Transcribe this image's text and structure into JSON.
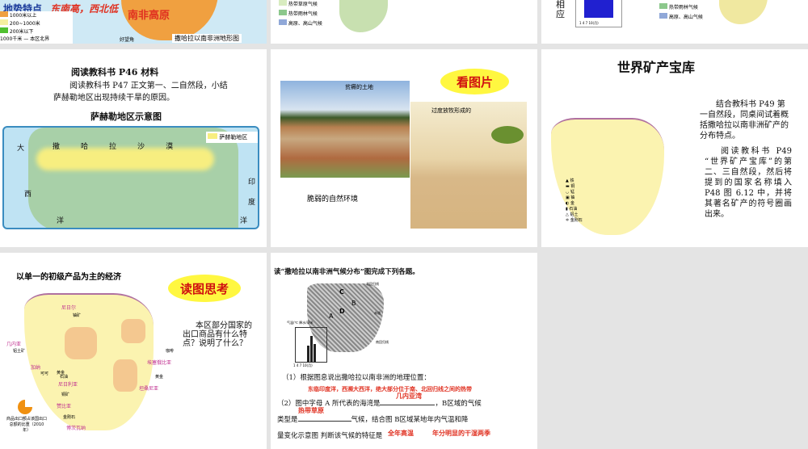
{
  "slides": [
    {
      "terrain": "地势特点",
      "terrain_value": "东南高，西北低",
      "plateau": "南非高原",
      "legend": [
        "1000米以上",
        "200~1000米",
        "200米以下"
      ],
      "scale": "1000千米",
      "boundary": "本区北界",
      "cape": "好望角",
      "caption": "撒哈拉以南非洲地形图"
    },
    {
      "legend": [
        "热带草原气候",
        "热带雨林气候",
        "高原、高山气候"
      ]
    },
    {
      "side": "相应",
      "legend": [
        "热带雨林气候",
        "高原、高山气候"
      ],
      "chart_months": "1 4 7 10(月)"
    },
    {
      "title": "阅读教科书 P46 材料",
      "body": "阅读教科书 P47 正文第一、二自然段，小结萨赫勒地区出现持续干旱的原因。",
      "map_title": "萨赫勒地区示意图",
      "legend": "萨赫勒地区",
      "labels": [
        "撒",
        "哈",
        "拉",
        "沙",
        "漠",
        "大",
        "西",
        "洋",
        "印",
        "度",
        "洋"
      ]
    },
    {
      "photo1": "贫瘠的土地",
      "photo2": "过度放牧形成的",
      "cloud": "看图片",
      "caption": "脆弱的自然环境"
    },
    {
      "title": "世界矿产宝库",
      "p1": "结合教科书 P49 第一自然段，同桌间试着概括撒哈拉以南非洲矿产的分布特点。",
      "p2": "阅读教科书 P49 “世界矿产宝库”的第二、三自然段，然后将提到的国家名称填入 P48 图 6.12 中，并将其著名矿产的符号圈画出来。",
      "legend": [
        "铁",
        "铜",
        "锰",
        "铀",
        "金",
        "石油",
        "铝土",
        "金刚石"
      ]
    },
    {
      "title": "以单一的初级产品为主的经济",
      "cloud": "读图思考",
      "body": "本区部分国家的出口商品有什么特点？说明了什么？",
      "countries": [
        "尼日尔",
        "几内亚",
        "加纳",
        "尼日利亚",
        "赞比亚",
        "博茨瓦纳",
        "埃塞俄比亚",
        "坦桑尼亚"
      ],
      "products": [
        "铀矿",
        "铝土矿",
        "黄金",
        "可可",
        "石油",
        "铜矿",
        "金刚石",
        "咖啡",
        "黄金"
      ],
      "legend_note": "商品出口额占该国出口总额的比重（2010年）"
    },
    {
      "title": "读“撒哈拉以南非洲气候分布”图完成下列各题。",
      "q1": "（1）根据图息说出撒哈拉以南非洲的地理位置：",
      "a1": "东临印度洋，西濒大西洋，绝大部分位于南、北回归线之间的热带",
      "q2a": "（2）图中字母 A 所代表的海湾是",
      "a2a": "几内亚湾",
      "q2b": "，B区域的气候",
      "q2c": "类型是",
      "a2b": "热带草原",
      "q2d": "气候，结合图 B区域某地年内气温和降",
      "q2e": "量变化示意图 判断该气候的特征是",
      "a2c": "全年高温",
      "a2d": "年分明显的干湿两季",
      "map_labels": [
        "C",
        "B",
        "D",
        "A",
        "北回归线",
        "赤道",
        "南回归线"
      ],
      "chart_axis": "气温/℃ 降水/毫米",
      "chart_months": "1 4 7 10(月)"
    }
  ]
}
